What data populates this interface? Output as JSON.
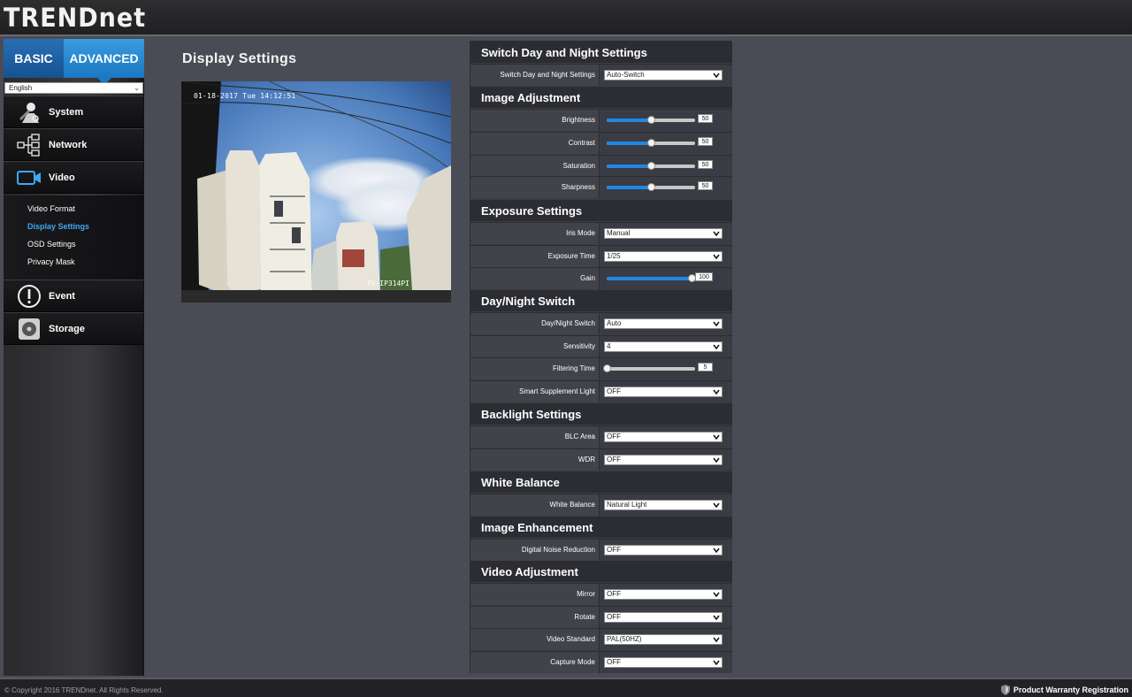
{
  "brand": {
    "logo_text": "TRENDnet"
  },
  "tabs": {
    "basic": "BASIC",
    "advanced": "ADVANCED"
  },
  "language": {
    "selected": "English"
  },
  "nav": {
    "system": "System",
    "network": "Network",
    "video": "Video",
    "event": "Event",
    "storage": "Storage",
    "video_sub": [
      "Video Format",
      "Display Settings",
      "OSD Settings",
      "Privacy Mask"
    ]
  },
  "page": {
    "title": "Display Settings"
  },
  "preview": {
    "osd_time": "01-18-2017 Tue 14:12:51",
    "osd_name": "TV-IP314PI"
  },
  "sections": {
    "day_night_switch_settings": {
      "title": "Switch Day and Night Settings",
      "row_label": "Switch Day and Night Settings",
      "row_value": "Auto-Switch"
    },
    "image_adjustment": {
      "title": "Image Adjustment",
      "brightness": {
        "label": "Brightness",
        "value": "50",
        "pct": 50
      },
      "contrast": {
        "label": "Contrast",
        "value": "50",
        "pct": 50
      },
      "saturation": {
        "label": "Saturation",
        "value": "50",
        "pct": 50
      },
      "sharpness": {
        "label": "Sharpness",
        "value": "50",
        "pct": 50
      }
    },
    "exposure": {
      "title": "Exposure Settings",
      "iris_label": "Iris Mode",
      "iris_value": "Manual",
      "time_label": "Exposure Time",
      "time_value": "1/25",
      "gain_label": "Gain",
      "gain_value": "100",
      "gain_pct": 100
    },
    "day_night": {
      "title": "Day/Night Switch",
      "switch_label": "Day/Night Switch",
      "switch_value": "Auto",
      "sens_label": "Sensitivity",
      "sens_value": "4",
      "filter_label": "Filtering Time",
      "filter_value": "5",
      "filter_pct": 0,
      "light_label": "Smart Supplement Light",
      "light_value": "OFF"
    },
    "backlight": {
      "title": "Backlight Settings",
      "blc_label": "BLC Area",
      "blc_value": "OFF",
      "wdr_label": "WDR",
      "wdr_value": "OFF"
    },
    "white_balance": {
      "title": "White Balance",
      "label": "White Balance",
      "value": "Natural Light"
    },
    "enhancement": {
      "title": "Image Enhancement",
      "label": "Digital Noise Reduction",
      "value": "OFF"
    },
    "video_adjustment": {
      "title": "Video Adjustment",
      "mirror_label": "Mirror",
      "mirror_value": "OFF",
      "rotate_label": "Rotate",
      "rotate_value": "OFF",
      "standard_label": "Video Standard",
      "standard_value": "PAL(50HZ)",
      "capture_label": "Capture Mode",
      "capture_value": "OFF"
    }
  },
  "footer": {
    "copyright": "© Copyright 2016 TRENDnet. All Rights Reserved.",
    "warranty": "Product Warranty Registration"
  },
  "colors": {
    "accent": "#1e88e5",
    "active_sub": "#3ea8f2"
  }
}
